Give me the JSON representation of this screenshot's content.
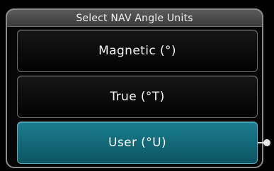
{
  "dialog": {
    "title": "Select NAV Angle Units"
  },
  "options": [
    {
      "label": "Magnetic (°)",
      "selected": false
    },
    {
      "label": "True (°T)",
      "selected": false
    },
    {
      "label": "User (°U)",
      "selected": true
    }
  ],
  "colors": {
    "selected_button": "#0f6c7c",
    "unselected_button": "#0a0a0a",
    "frame_border": "#8c8c8c"
  }
}
